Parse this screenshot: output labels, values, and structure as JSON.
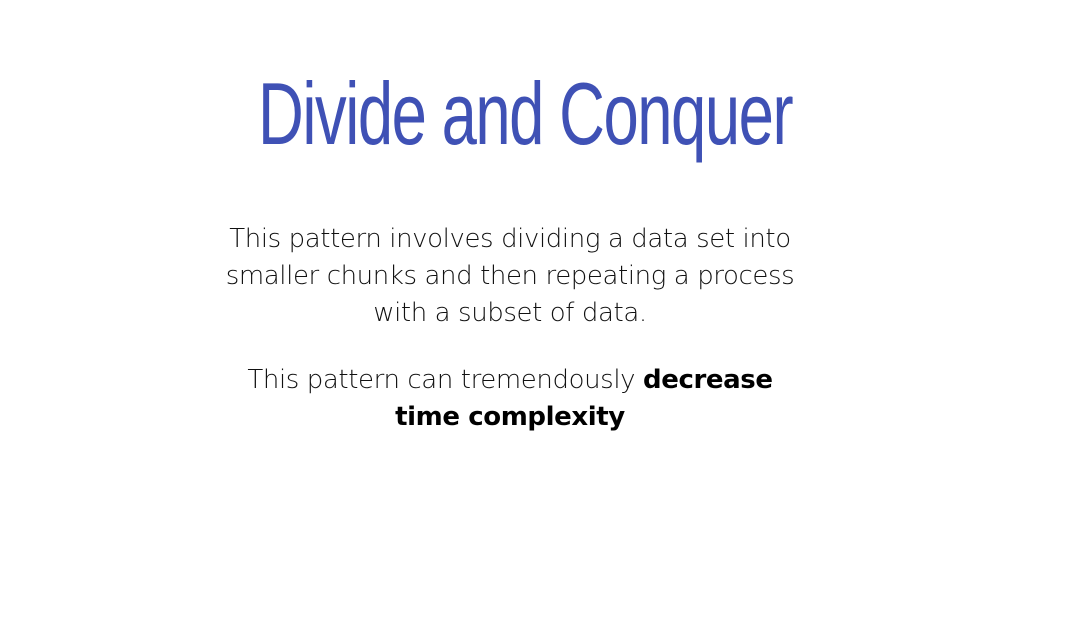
{
  "slide": {
    "title": "Divide and Conquer",
    "paragraph1": "This pattern involves dividing a data set into smaller chunks and then repeating a process with a subset of data.",
    "paragraph2_prefix": "This pattern can tremendously ",
    "paragraph2_bold": "decrease time complexity"
  },
  "colors": {
    "title": "#3f51b5",
    "text": "#111111",
    "background": "#ffffff"
  }
}
